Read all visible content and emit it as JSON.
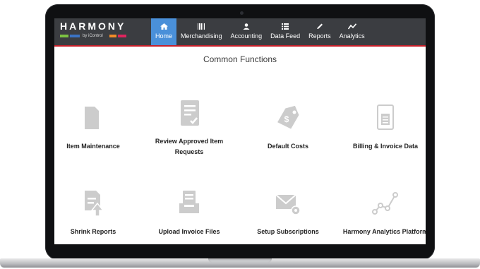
{
  "app": {
    "logo_text": "HARMONY",
    "logo_sub": "by iControl",
    "logo_colors": [
      "#7cc242",
      "#3b73c4",
      "#f28c28",
      "#e0245e"
    ]
  },
  "nav": {
    "items": [
      {
        "label": "Home",
        "icon": "home-icon",
        "active": true
      },
      {
        "label": "Merchandising",
        "icon": "barcode-icon",
        "active": false
      },
      {
        "label": "Accounting",
        "icon": "user-icon",
        "active": false
      },
      {
        "label": "Data Feed",
        "icon": "list-icon",
        "active": false
      },
      {
        "label": "Reports",
        "icon": "pencil-icon",
        "active": false
      },
      {
        "label": "Analytics",
        "icon": "trend-icon",
        "active": false
      }
    ],
    "active_color": "#4a90d9",
    "accent_color": "#c8202a"
  },
  "main": {
    "title": "Common Functions",
    "tiles": [
      {
        "label": "Item Maintenance",
        "icon": "folder-icon"
      },
      {
        "label": "Review Approved Item Requests",
        "icon": "approved-document-icon"
      },
      {
        "label": "Default Costs",
        "icon": "price-tag-icon"
      },
      {
        "label": "Billing & Invoice Data",
        "icon": "invoice-document-icon"
      },
      {
        "label": "Shrink Reports",
        "icon": "report-upload-icon"
      },
      {
        "label": "Upload Invoice Files",
        "icon": "inbox-upload-icon"
      },
      {
        "label": "Setup Subscriptions",
        "icon": "mail-settings-icon"
      },
      {
        "label": "Harmony Analytics Platform",
        "icon": "analytics-line-icon"
      }
    ],
    "icon_color": "#cccccc"
  }
}
